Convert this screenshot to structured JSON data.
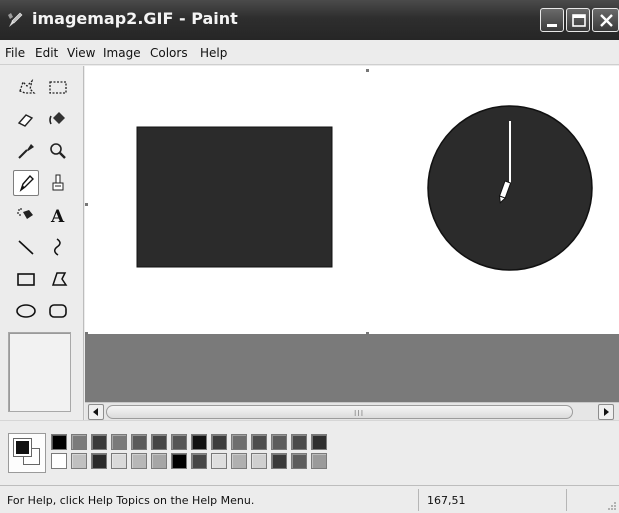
{
  "window": {
    "title": "imagemap2.GIF - Paint",
    "app_icon": "paint-brush-icon",
    "controls": [
      "minimize-icon",
      "maximize-icon",
      "close-icon"
    ]
  },
  "menubar": {
    "items": [
      "File",
      "Edit",
      "View",
      "Image",
      "Colors",
      "Help"
    ]
  },
  "toolbox": {
    "tools": [
      {
        "name": "free-form-select-icon"
      },
      {
        "name": "select-icon"
      },
      {
        "name": "eraser-icon"
      },
      {
        "name": "fill-with-color-icon"
      },
      {
        "name": "pick-color-icon"
      },
      {
        "name": "magnifier-icon"
      },
      {
        "name": "pencil-icon",
        "selected": true
      },
      {
        "name": "brush-icon"
      },
      {
        "name": "airbrush-icon"
      },
      {
        "name": "text-icon",
        "glyph": "A"
      },
      {
        "name": "line-icon"
      },
      {
        "name": "curve-icon"
      },
      {
        "name": "rectangle-icon"
      },
      {
        "name": "polygon-icon"
      },
      {
        "name": "ellipse-icon"
      },
      {
        "name": "rounded-rectangle-icon"
      }
    ]
  },
  "canvas": {
    "shapes": [
      "filled-rectangle",
      "filled-circle"
    ],
    "fill_color": "#2b2b2b",
    "background": "#ffffff",
    "workspace_color": "#7a7a7a",
    "cursor": "pencil-cursor-icon"
  },
  "scrollbar": {
    "grip": "III"
  },
  "colors": {
    "foreground": "#111111",
    "background": "#ffffff",
    "palette_top": [
      "#000000",
      "#7b7b7b",
      "#3a3a3a",
      "#7a7a7a",
      "#5a5a5a",
      "#464646",
      "#555555",
      "#111111",
      "#3c3c3c",
      "#6e6e6e",
      "#4d4d4d",
      "#5c5c5c",
      "#4a4a4a",
      "#2f2f2f"
    ],
    "palette_bottom": [
      "#ffffff",
      "#c0c0c0",
      "#2a2a2a",
      "#d9d9d9",
      "#b7b7b7",
      "#a6a6a6",
      "#000000",
      "#474747",
      "#dedede",
      "#b0b0b0",
      "#cfcfcf",
      "#3a3a3a",
      "#5d5d5d",
      "#9a9a9a"
    ]
  },
  "status": {
    "help_text": "For Help, click Help Topics on the Help Menu.",
    "coordinates": "167,51"
  }
}
